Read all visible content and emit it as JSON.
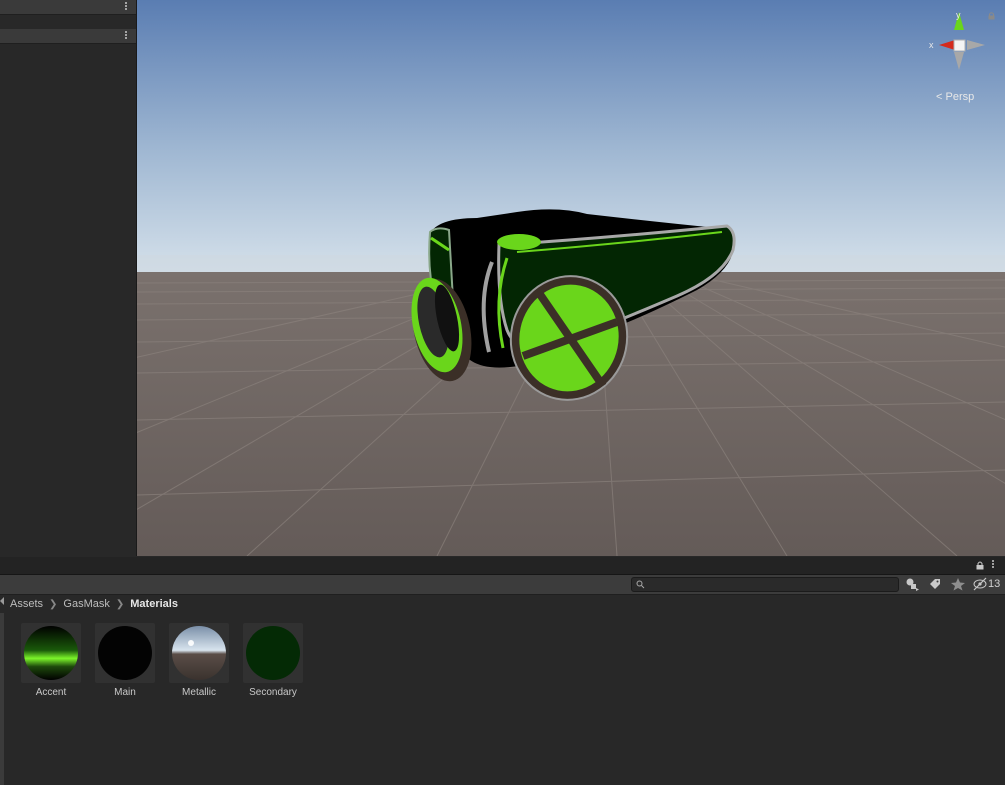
{
  "scene_view": {
    "projection_label": "Persp",
    "gizmo_axis_x": "x",
    "gizmo_axis_y": "y",
    "colors": {
      "sky_top": "#5f82b5",
      "sky_horizon": "#c9d8e8",
      "ground": "#6a625f",
      "accent_green": "#6ad61b",
      "dark_green": "#032603"
    }
  },
  "project": {
    "breadcrumb": [
      {
        "label": "Assets"
      },
      {
        "label": "GasMask"
      },
      {
        "label": "Materials"
      }
    ],
    "search": {
      "placeholder": ""
    },
    "hidden_packages_count": "13",
    "assets": [
      {
        "label": "Accent",
        "icon": "material-accent-icon"
      },
      {
        "label": "Main",
        "icon": "material-main-icon"
      },
      {
        "label": "Metallic",
        "icon": "material-metallic-icon"
      },
      {
        "label": "Secondary",
        "icon": "material-secondary-icon"
      }
    ]
  }
}
